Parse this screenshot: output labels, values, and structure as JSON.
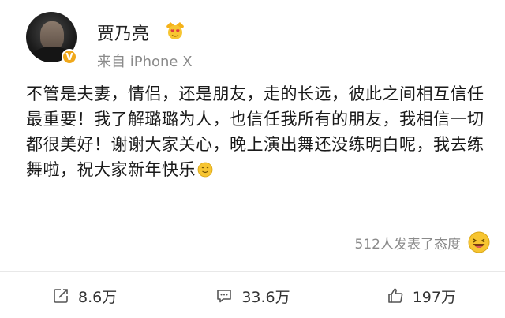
{
  "post": {
    "username": "贾乃亮",
    "source": "来自 iPhone X",
    "content": "不管是夫妻，情侣，还是朋友，走的长远，彼此之间相互信任最重要！我了解璐璐为人，也信任我所有的朋友，我相信一切都很美好！谢谢大家关心，晚上演出舞还没练明白呢，我去练舞啦，祝大家新年快乐",
    "reactions_text": "512人发表了态度"
  },
  "actions": {
    "repost_count": "8.6万",
    "comment_count": "33.6万",
    "like_count": "197万"
  },
  "icons": {
    "verified": "verified-badge-icon",
    "crown": "crown-heart-eyes-emoji-icon",
    "smile": "smile-emoji-icon",
    "laugh": "laugh-emoji-icon",
    "repost": "repost-icon",
    "comment": "comment-icon",
    "like": "thumbs-up-icon"
  },
  "colors": {
    "verified_badge": "#f0a81b",
    "secondary_text": "#8a8a8a",
    "emoji_yellow": "#f7c531"
  }
}
